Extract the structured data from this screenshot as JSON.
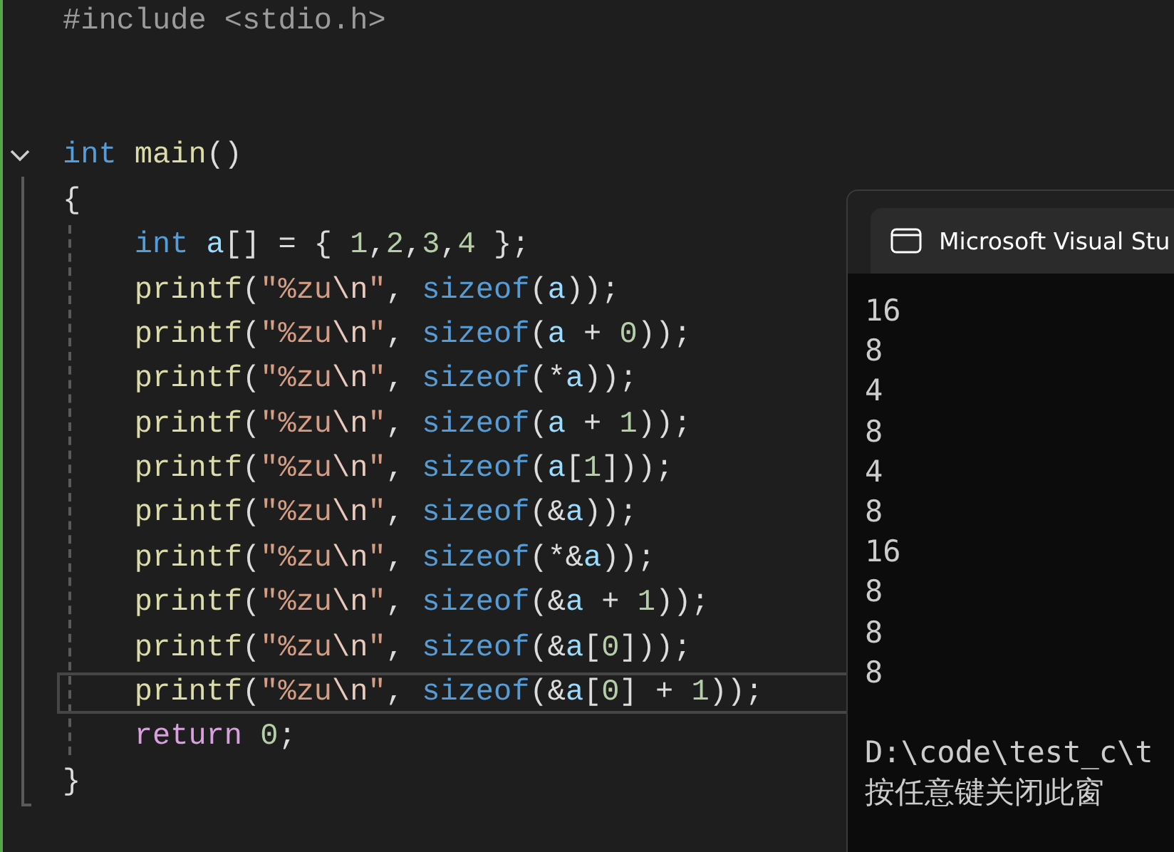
{
  "editor": {
    "lines": [
      {
        "kind": "code",
        "foldable": false,
        "current": false,
        "indented": false,
        "tokens": [
          {
            "kind": "pre",
            "text": "#include <stdio.h>"
          }
        ]
      },
      {
        "kind": "blank"
      },
      {
        "kind": "blank"
      },
      {
        "kind": "code",
        "foldable": true,
        "current": false,
        "indented": false,
        "tokens": [
          {
            "kind": "keyword",
            "text": "int"
          },
          {
            "kind": "func",
            "text": " main"
          },
          {
            "kind": "plain",
            "text": "()"
          }
        ]
      },
      {
        "kind": "code",
        "foldable": false,
        "current": false,
        "indented": false,
        "tokens": [
          {
            "kind": "plain",
            "text": "{"
          }
        ]
      },
      {
        "kind": "code",
        "foldable": false,
        "current": false,
        "indented": true,
        "tokens": [
          {
            "kind": "keyword",
            "text": "int"
          },
          {
            "kind": "var",
            "text": " a"
          },
          {
            "kind": "plain",
            "text": "[] = { "
          },
          {
            "kind": "number",
            "text": "1"
          },
          {
            "kind": "plain",
            "text": ","
          },
          {
            "kind": "number",
            "text": "2"
          },
          {
            "kind": "plain",
            "text": ","
          },
          {
            "kind": "number",
            "text": "3"
          },
          {
            "kind": "plain",
            "text": ","
          },
          {
            "kind": "number",
            "text": "4"
          },
          {
            "kind": "plain",
            "text": " };"
          }
        ]
      },
      {
        "kind": "code",
        "foldable": false,
        "current": false,
        "indented": true,
        "tokens": [
          {
            "kind": "func",
            "text": "printf"
          },
          {
            "kind": "plain",
            "text": "("
          },
          {
            "kind": "string",
            "text": "\"%zu"
          },
          {
            "kind": "escape",
            "text": "\\n"
          },
          {
            "kind": "string",
            "text": "\""
          },
          {
            "kind": "plain",
            "text": ", "
          },
          {
            "kind": "keyword",
            "text": "sizeof"
          },
          {
            "kind": "plain",
            "text": "("
          },
          {
            "kind": "var",
            "text": "a"
          },
          {
            "kind": "plain",
            "text": "));"
          }
        ]
      },
      {
        "kind": "code",
        "foldable": false,
        "current": false,
        "indented": true,
        "tokens": [
          {
            "kind": "func",
            "text": "printf"
          },
          {
            "kind": "plain",
            "text": "("
          },
          {
            "kind": "string",
            "text": "\"%zu"
          },
          {
            "kind": "escape",
            "text": "\\n"
          },
          {
            "kind": "string",
            "text": "\""
          },
          {
            "kind": "plain",
            "text": ", "
          },
          {
            "kind": "keyword",
            "text": "sizeof"
          },
          {
            "kind": "plain",
            "text": "("
          },
          {
            "kind": "var",
            "text": "a"
          },
          {
            "kind": "plain",
            "text": " + "
          },
          {
            "kind": "number",
            "text": "0"
          },
          {
            "kind": "plain",
            "text": "));"
          }
        ]
      },
      {
        "kind": "code",
        "foldable": false,
        "current": false,
        "indented": true,
        "tokens": [
          {
            "kind": "func",
            "text": "printf"
          },
          {
            "kind": "plain",
            "text": "("
          },
          {
            "kind": "string",
            "text": "\"%zu"
          },
          {
            "kind": "escape",
            "text": "\\n"
          },
          {
            "kind": "string",
            "text": "\""
          },
          {
            "kind": "plain",
            "text": ", "
          },
          {
            "kind": "keyword",
            "text": "sizeof"
          },
          {
            "kind": "plain",
            "text": "(*"
          },
          {
            "kind": "var",
            "text": "a"
          },
          {
            "kind": "plain",
            "text": "));"
          }
        ]
      },
      {
        "kind": "code",
        "foldable": false,
        "current": false,
        "indented": true,
        "tokens": [
          {
            "kind": "func",
            "text": "printf"
          },
          {
            "kind": "plain",
            "text": "("
          },
          {
            "kind": "string",
            "text": "\"%zu"
          },
          {
            "kind": "escape",
            "text": "\\n"
          },
          {
            "kind": "string",
            "text": "\""
          },
          {
            "kind": "plain",
            "text": ", "
          },
          {
            "kind": "keyword",
            "text": "sizeof"
          },
          {
            "kind": "plain",
            "text": "("
          },
          {
            "kind": "var",
            "text": "a"
          },
          {
            "kind": "plain",
            "text": " + "
          },
          {
            "kind": "number",
            "text": "1"
          },
          {
            "kind": "plain",
            "text": "));"
          }
        ]
      },
      {
        "kind": "code",
        "foldable": false,
        "current": false,
        "indented": true,
        "tokens": [
          {
            "kind": "func",
            "text": "printf"
          },
          {
            "kind": "plain",
            "text": "("
          },
          {
            "kind": "string",
            "text": "\"%zu"
          },
          {
            "kind": "escape",
            "text": "\\n"
          },
          {
            "kind": "string",
            "text": "\""
          },
          {
            "kind": "plain",
            "text": ", "
          },
          {
            "kind": "keyword",
            "text": "sizeof"
          },
          {
            "kind": "plain",
            "text": "("
          },
          {
            "kind": "var",
            "text": "a"
          },
          {
            "kind": "plain",
            "text": "["
          },
          {
            "kind": "number",
            "text": "1"
          },
          {
            "kind": "plain",
            "text": "]));"
          }
        ]
      },
      {
        "kind": "code",
        "foldable": false,
        "current": false,
        "indented": true,
        "tokens": [
          {
            "kind": "func",
            "text": "printf"
          },
          {
            "kind": "plain",
            "text": "("
          },
          {
            "kind": "string",
            "text": "\"%zu"
          },
          {
            "kind": "escape",
            "text": "\\n"
          },
          {
            "kind": "string",
            "text": "\""
          },
          {
            "kind": "plain",
            "text": ", "
          },
          {
            "kind": "keyword",
            "text": "sizeof"
          },
          {
            "kind": "plain",
            "text": "(&"
          },
          {
            "kind": "var",
            "text": "a"
          },
          {
            "kind": "plain",
            "text": "));"
          }
        ]
      },
      {
        "kind": "code",
        "foldable": false,
        "current": false,
        "indented": true,
        "tokens": [
          {
            "kind": "func",
            "text": "printf"
          },
          {
            "kind": "plain",
            "text": "("
          },
          {
            "kind": "string",
            "text": "\"%zu"
          },
          {
            "kind": "escape",
            "text": "\\n"
          },
          {
            "kind": "string",
            "text": "\""
          },
          {
            "kind": "plain",
            "text": ", "
          },
          {
            "kind": "keyword",
            "text": "sizeof"
          },
          {
            "kind": "plain",
            "text": "(*&"
          },
          {
            "kind": "var",
            "text": "a"
          },
          {
            "kind": "plain",
            "text": "));"
          }
        ]
      },
      {
        "kind": "code",
        "foldable": false,
        "current": false,
        "indented": true,
        "tokens": [
          {
            "kind": "func",
            "text": "printf"
          },
          {
            "kind": "plain",
            "text": "("
          },
          {
            "kind": "string",
            "text": "\"%zu"
          },
          {
            "kind": "escape",
            "text": "\\n"
          },
          {
            "kind": "string",
            "text": "\""
          },
          {
            "kind": "plain",
            "text": ", "
          },
          {
            "kind": "keyword",
            "text": "sizeof"
          },
          {
            "kind": "plain",
            "text": "(&"
          },
          {
            "kind": "var",
            "text": "a"
          },
          {
            "kind": "plain",
            "text": " + "
          },
          {
            "kind": "number",
            "text": "1"
          },
          {
            "kind": "plain",
            "text": "));"
          }
        ]
      },
      {
        "kind": "code",
        "foldable": false,
        "current": false,
        "indented": true,
        "tokens": [
          {
            "kind": "func",
            "text": "printf"
          },
          {
            "kind": "plain",
            "text": "("
          },
          {
            "kind": "string",
            "text": "\"%zu"
          },
          {
            "kind": "escape",
            "text": "\\n"
          },
          {
            "kind": "string",
            "text": "\""
          },
          {
            "kind": "plain",
            "text": ", "
          },
          {
            "kind": "keyword",
            "text": "sizeof"
          },
          {
            "kind": "plain",
            "text": "(&"
          },
          {
            "kind": "var",
            "text": "a"
          },
          {
            "kind": "plain",
            "text": "["
          },
          {
            "kind": "number",
            "text": "0"
          },
          {
            "kind": "plain",
            "text": "]));"
          }
        ]
      },
      {
        "kind": "code",
        "foldable": false,
        "current": true,
        "indented": true,
        "tokens": [
          {
            "kind": "func",
            "text": "printf"
          },
          {
            "kind": "plain",
            "text": "("
          },
          {
            "kind": "string",
            "text": "\"%zu"
          },
          {
            "kind": "escape",
            "text": "\\n"
          },
          {
            "kind": "string",
            "text": "\""
          },
          {
            "kind": "plain",
            "text": ", "
          },
          {
            "kind": "keyword",
            "text": "sizeof"
          },
          {
            "kind": "plain",
            "text": "(&"
          },
          {
            "kind": "var",
            "text": "a"
          },
          {
            "kind": "plain",
            "text": "["
          },
          {
            "kind": "number",
            "text": "0"
          },
          {
            "kind": "plain",
            "text": "] + "
          },
          {
            "kind": "number",
            "text": "1"
          },
          {
            "kind": "plain",
            "text": "));"
          }
        ]
      },
      {
        "kind": "code",
        "foldable": false,
        "current": false,
        "indented": true,
        "tokens": [
          {
            "kind": "control",
            "text": "return"
          },
          {
            "kind": "number",
            "text": " 0"
          },
          {
            "kind": "plain",
            "text": ";"
          }
        ]
      },
      {
        "kind": "code",
        "foldable": false,
        "current": false,
        "indented": false,
        "tokens": [
          {
            "kind": "plain",
            "text": "}"
          }
        ]
      }
    ]
  },
  "console": {
    "title": "Microsoft Visual Stu",
    "output": [
      "16",
      "8",
      "4",
      "8",
      "4",
      "8",
      "16",
      "8",
      "8",
      "8"
    ],
    "path": "D:\\code\\test_c\\t",
    "prompt": "按任意键关闭此窗"
  }
}
